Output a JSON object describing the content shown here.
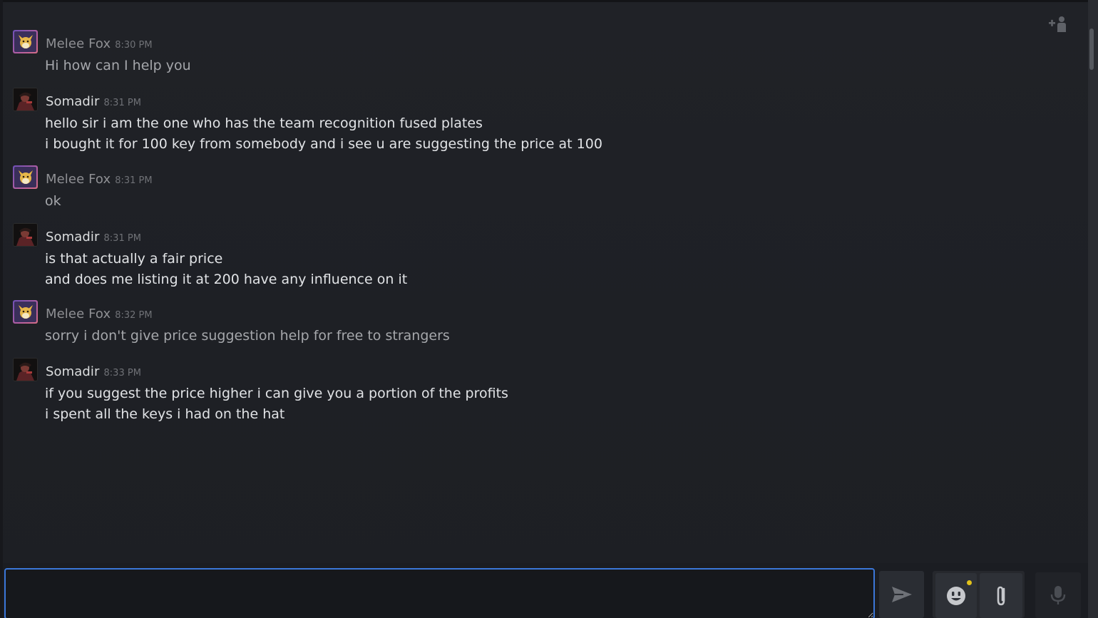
{
  "toolbar": {
    "add_friend_icon": "add-friend-icon"
  },
  "colors": {
    "accent_focus": "#3b77d9",
    "notification_dot": "#e2c21a",
    "own_name": "#8f9094",
    "friend_name": "#dcdedf"
  },
  "messages": [
    {
      "sender": "Melee Fox",
      "time": "8:30 PM",
      "avatar": "fox-avatar",
      "lines": [
        "Hi how can I help you"
      ]
    },
    {
      "sender": "Somadir",
      "time": "8:31 PM",
      "avatar": "somadir-avatar",
      "lines": [
        "hello sir i am the one who has the team recognition fused plates",
        "i bought it for 100 key from somebody and i see u are suggesting the price at 100"
      ]
    },
    {
      "sender": "Melee Fox",
      "time": "8:31 PM",
      "avatar": "fox-avatar",
      "lines": [
        "ok"
      ]
    },
    {
      "sender": "Somadir",
      "time": "8:31 PM",
      "avatar": "somadir-avatar",
      "lines": [
        "is that actually a fair price",
        "and does me listing it at 200 have any influence on it"
      ]
    },
    {
      "sender": "Melee Fox",
      "time": "8:32 PM",
      "avatar": "fox-avatar",
      "lines": [
        "sorry i don't give price suggestion help for free to strangers"
      ]
    },
    {
      "sender": "Somadir",
      "time": "8:33 PM",
      "avatar": "somadir-avatar",
      "lines": [
        "if you suggest the price higher i can give you a portion of the profits",
        "i spent all the keys i had on the hat"
      ]
    }
  ],
  "composer": {
    "value": "",
    "placeholder": "",
    "send_icon": "send-icon",
    "emoji_icon": "emoji-icon",
    "attach_icon": "paperclip-icon",
    "voice_icon": "microphone-icon"
  }
}
